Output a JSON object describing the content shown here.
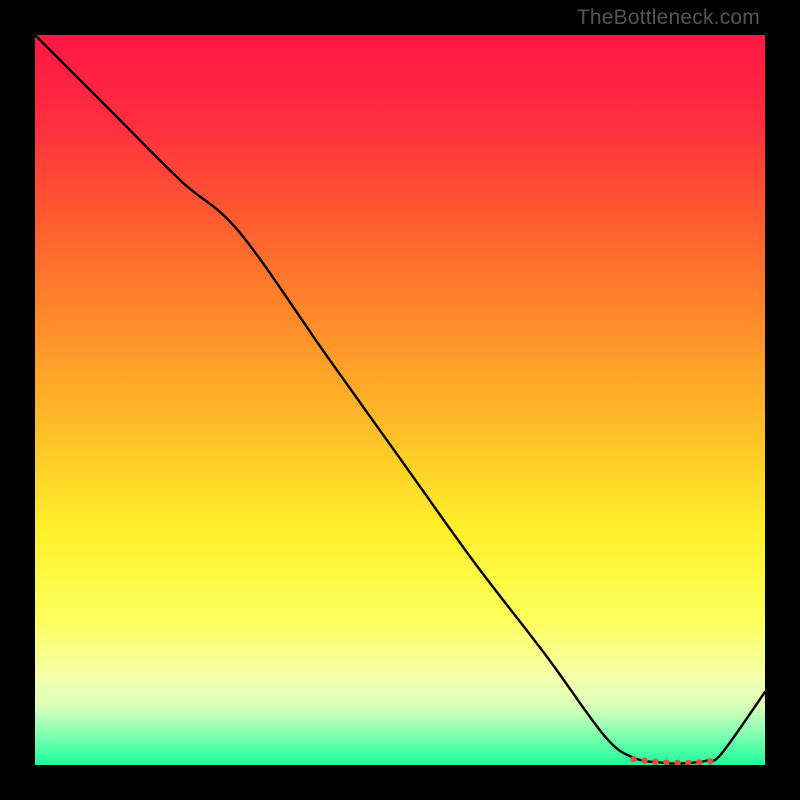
{
  "watermark": "TheBottleneck.com",
  "chart_data": {
    "type": "line",
    "title": "",
    "xlabel": "",
    "ylabel": "",
    "xlim": [
      0,
      100
    ],
    "ylim": [
      0,
      100
    ],
    "gradient_stops": [
      {
        "offset": 0,
        "color": "#ff1744"
      },
      {
        "offset": 12,
        "color": "#ff2e3f"
      },
      {
        "offset": 25,
        "color": "#ff5a2f"
      },
      {
        "offset": 40,
        "color": "#ff8e2a"
      },
      {
        "offset": 55,
        "color": "#ffc127"
      },
      {
        "offset": 68,
        "color": "#fff12a"
      },
      {
        "offset": 80,
        "color": "#fcff5a"
      },
      {
        "offset": 88,
        "color": "#f5ffab"
      },
      {
        "offset": 92,
        "color": "#d9ffba"
      },
      {
        "offset": 96,
        "color": "#7dffb0"
      },
      {
        "offset": 100,
        "color": "#1bff9a"
      }
    ],
    "series": [
      {
        "name": "curve",
        "x": [
          0,
          10,
          20,
          28,
          40,
          50,
          60,
          70,
          78,
          82,
          86,
          88,
          90,
          92,
          94,
          100
        ],
        "y": [
          100,
          90,
          80,
          73,
          56,
          42,
          28,
          15,
          4,
          1,
          0.3,
          0.2,
          0.3,
          0.6,
          1.5,
          10
        ]
      }
    ],
    "markers": {
      "x": [
        82,
        83.5,
        85,
        86.5,
        88,
        89.5,
        91,
        92.5
      ],
      "y": [
        0.8,
        0.6,
        0.45,
        0.35,
        0.3,
        0.3,
        0.35,
        0.5
      ],
      "color": "#e74c3c",
      "radius": 3.2
    }
  }
}
